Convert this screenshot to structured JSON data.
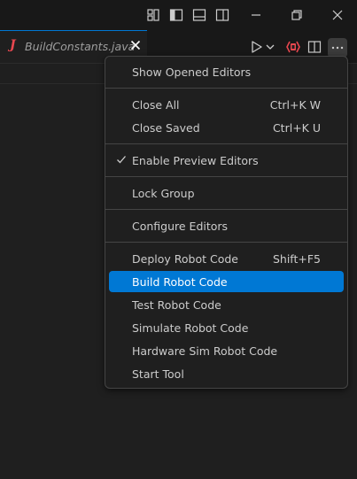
{
  "window": {
    "layout_icon": "customize-layout-icon",
    "controls": [
      "toggle-primary-sidebar-icon",
      "toggle-panel-icon",
      "toggle-secondary-sidebar-icon",
      "minimize-icon",
      "restore-icon",
      "close-icon"
    ]
  },
  "tab": {
    "label": "BuildConstants.java",
    "lang_glyph": "J",
    "lang_icon": "java-icon",
    "colors": {
      "active_border": "#0078d4",
      "lang_icon": "#e8474f"
    }
  },
  "editor_actions": [
    "run-icon",
    "dropdown-chevron-icon",
    "robot-icon",
    "split-editor-icon",
    "more-actions-icon"
  ],
  "menu": {
    "items": [
      {
        "label": "Show Opened Editors",
        "key": ""
      },
      {
        "label": "Close All",
        "key": "Ctrl+K W"
      },
      {
        "label": "Close Saved",
        "key": "Ctrl+K U"
      },
      {
        "label": "Enable Preview Editors",
        "key": "",
        "checked": true
      },
      {
        "label": "Lock Group",
        "key": ""
      },
      {
        "label": "Configure Editors",
        "key": ""
      },
      {
        "label": "Deploy Robot Code",
        "key": "Shift+F5"
      },
      {
        "label": "Build Robot Code",
        "key": "",
        "active": true
      },
      {
        "label": "Test Robot Code",
        "key": ""
      },
      {
        "label": "Simulate Robot Code",
        "key": ""
      },
      {
        "label": "Hardware Sim Robot Code",
        "key": ""
      },
      {
        "label": "Start Tool",
        "key": ""
      }
    ],
    "colors": {
      "highlight": "#0078d4",
      "background": "#1f1f1f",
      "border": "#454545"
    }
  }
}
